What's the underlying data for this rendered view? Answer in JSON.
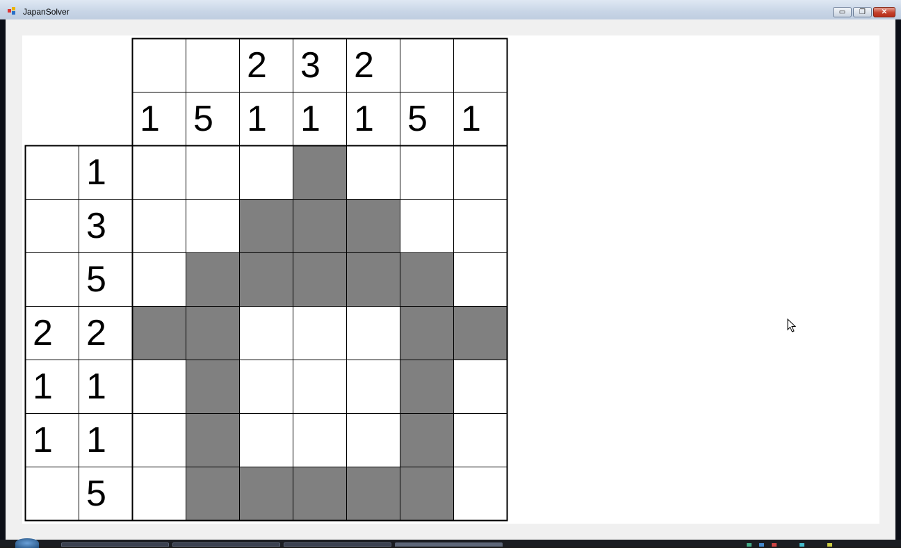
{
  "window": {
    "title": "JapanSolver",
    "buttons": {
      "minimize": "▭",
      "restore": "❐",
      "close": "✕"
    }
  },
  "puzzle": {
    "column_clues": [
      [
        "1"
      ],
      [
        "5"
      ],
      [
        "2",
        "1"
      ],
      [
        "3",
        "1"
      ],
      [
        "2",
        "1"
      ],
      [
        "5"
      ],
      [
        "1"
      ]
    ],
    "row_clues": [
      [
        "1"
      ],
      [
        "3"
      ],
      [
        "5"
      ],
      [
        "2",
        "2"
      ],
      [
        "1",
        "1"
      ],
      [
        "1",
        "1"
      ],
      [
        "5"
      ]
    ],
    "grid": [
      [
        0,
        0,
        0,
        1,
        0,
        0,
        0
      ],
      [
        0,
        0,
        1,
        1,
        1,
        0,
        0
      ],
      [
        0,
        1,
        1,
        1,
        1,
        1,
        0
      ],
      [
        1,
        1,
        0,
        0,
        0,
        1,
        1
      ],
      [
        0,
        1,
        0,
        0,
        0,
        1,
        0
      ],
      [
        0,
        1,
        0,
        0,
        0,
        1,
        0
      ],
      [
        0,
        1,
        1,
        1,
        1,
        1,
        0
      ]
    ]
  },
  "colors": {
    "filled": "#808080",
    "empty": "#ffffff",
    "grid_line": "#000000",
    "panel": "#ffffff",
    "form_background": "#f0f0f0"
  },
  "icons": {
    "app": "app-icon",
    "cursor": "mouse-pointer-icon"
  }
}
